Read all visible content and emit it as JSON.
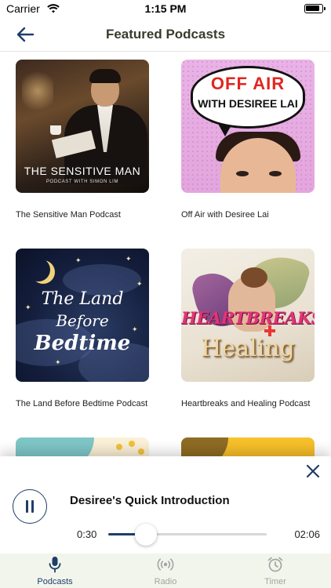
{
  "status_bar": {
    "carrier": "Carrier",
    "time": "1:15 PM"
  },
  "nav": {
    "title": "Featured Podcasts"
  },
  "podcasts": [
    {
      "title": "The Sensitive Man Podcast",
      "cover_title": "THE SENSITIVE MAN",
      "cover_subtitle": "PODCAST WITH SIMON LIM"
    },
    {
      "title": "Off Air with Desiree Lai",
      "cover_title": "OFF AIR",
      "cover_subtitle": "WITH DESIREE LAI"
    },
    {
      "title": "The Land Before Bedtime Podcast",
      "cover_line1": "The Land",
      "cover_line2": "Before",
      "cover_line3": "Bedtime"
    },
    {
      "title": "Heartbreaks and Healing Podcast",
      "cover_line1": "HEARTBREAKS",
      "cover_line2": "Healing"
    }
  ],
  "player": {
    "episode_title": "Desiree's Quick Introduction",
    "elapsed": "0:30",
    "total": "02:06",
    "progress_fraction": 0.238
  },
  "tabs": [
    {
      "label": "Podcasts",
      "icon": "microphone-icon",
      "active": true
    },
    {
      "label": "Radio",
      "icon": "radio-waves-icon",
      "active": false
    },
    {
      "label": "Timer",
      "icon": "alarm-clock-icon",
      "active": false
    }
  ],
  "colors": {
    "accent": "#1f3d6a",
    "nav_title": "#3a3a2c",
    "tab_bar_bg": "#f1f5ec",
    "inactive": "#a4a4a4"
  }
}
